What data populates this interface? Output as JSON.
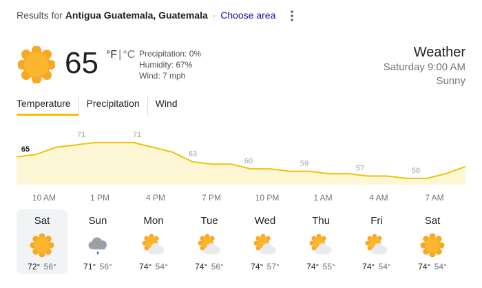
{
  "header": {
    "prefix": "Results for",
    "location": "Antigua Guatemala, Guatemala",
    "separator": "·",
    "choose_area": "Choose area",
    "more_icon": "more-vert-icon"
  },
  "current": {
    "icon": "sunny-icon",
    "temperature": "65",
    "unit_f": "°F",
    "unit_sep": "|",
    "unit_c": "°C",
    "precipitation": "Precipitation: 0%",
    "humidity": "Humidity: 67%",
    "wind": "Wind: 7 mph"
  },
  "summary": {
    "title": "Weather",
    "datetime": "Saturday 9:00 AM",
    "condition": "Sunny"
  },
  "tabs": [
    {
      "label": "Temperature",
      "active": true
    },
    {
      "label": "Precipitation",
      "active": false
    },
    {
      "label": "Wind",
      "active": false
    }
  ],
  "colors": {
    "graph_line": "#f2c100",
    "graph_fill": "#fef7d6",
    "tab_underline": "#fbbc04",
    "sun": "#f9a825"
  },
  "chart_data": {
    "type": "area",
    "x": [
      "10 AM",
      "1 PM",
      "4 PM",
      "7 PM",
      "10 PM",
      "1 AM",
      "4 AM",
      "7 AM"
    ],
    "labels": [
      "65",
      "71",
      "71",
      "63",
      "60",
      "59",
      "57",
      "56"
    ],
    "values": [
      65,
      71,
      71,
      63,
      60,
      59,
      57,
      56
    ],
    "series_detail": [
      65,
      66,
      69,
      70,
      71,
      71,
      71,
      69,
      67,
      63,
      62,
      62,
      60,
      60,
      59,
      59,
      58,
      58,
      57,
      57,
      56,
      56,
      58,
      61
    ]
  },
  "time_labels": [
    "10 AM",
    "1 PM",
    "4 PM",
    "7 PM",
    "10 PM",
    "1 AM",
    "4 AM",
    "7 AM"
  ],
  "days": [
    {
      "name": "Sat",
      "icon": "sunny-icon",
      "high": "72°",
      "low": "56°",
      "selected": true
    },
    {
      "name": "Sun",
      "icon": "rain-cloud-icon",
      "high": "71°",
      "low": "56°",
      "selected": false
    },
    {
      "name": "Mon",
      "icon": "partly-cloudy-icon",
      "high": "74°",
      "low": "54°",
      "selected": false
    },
    {
      "name": "Tue",
      "icon": "partly-cloudy-icon",
      "high": "74°",
      "low": "56°",
      "selected": false
    },
    {
      "name": "Wed",
      "icon": "partly-cloudy-icon",
      "high": "74°",
      "low": "57°",
      "selected": false
    },
    {
      "name": "Thu",
      "icon": "partly-cloudy-icon",
      "high": "74°",
      "low": "55°",
      "selected": false
    },
    {
      "name": "Fri",
      "icon": "partly-cloudy-icon",
      "high": "74°",
      "low": "54°",
      "selected": false
    },
    {
      "name": "Sat",
      "icon": "sunny-icon",
      "high": "74°",
      "low": "54°",
      "selected": false
    }
  ]
}
